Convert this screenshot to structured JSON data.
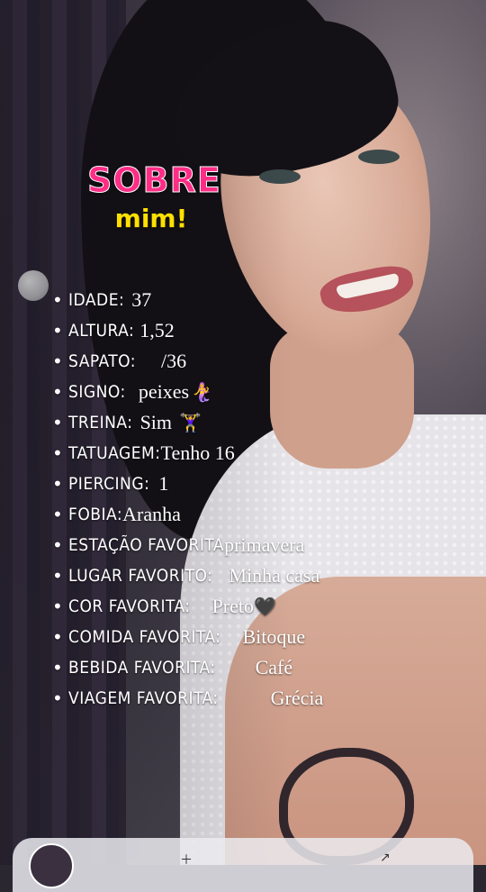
{
  "title": {
    "line1": "SOBRE",
    "line2": "mim!"
  },
  "items": [
    {
      "label": "IDADE:",
      "value": "37"
    },
    {
      "label": "ALTURA:",
      "value": "1,52"
    },
    {
      "label": "SAPATO:",
      "value": "/36"
    },
    {
      "label": "SIGNO:",
      "value": "peixes",
      "emoji": "🧜‍♀️"
    },
    {
      "label": "TREINA:",
      "value": "Sim",
      "emoji": "🏋️‍♀️"
    },
    {
      "label": "TATUAGEM:",
      "value": "Tenho 16"
    },
    {
      "label": "PIERCING:",
      "value": "1"
    },
    {
      "label": "FOBIA:",
      "value": "Aranha"
    },
    {
      "label": "ESTAÇÃO FAVORITA",
      "value": "primavera"
    },
    {
      "label": "LUGAR FAVORITO:",
      "value": "Minha casa"
    },
    {
      "label": "COR FAVORITA:",
      "value": "Preto",
      "emoji": "🖤"
    },
    {
      "label": "COMIDA FAVORITA:",
      "value": "Bitoque"
    },
    {
      "label": "BEBIDA FAVORITA:",
      "value": "Café"
    },
    {
      "label": "VIAGEM FAVORITA:",
      "value": "Grécia"
    }
  ],
  "colors": {
    "title_pink": "#ff2d86",
    "title_yellow": "#ffe000",
    "text": "#ffffff"
  }
}
